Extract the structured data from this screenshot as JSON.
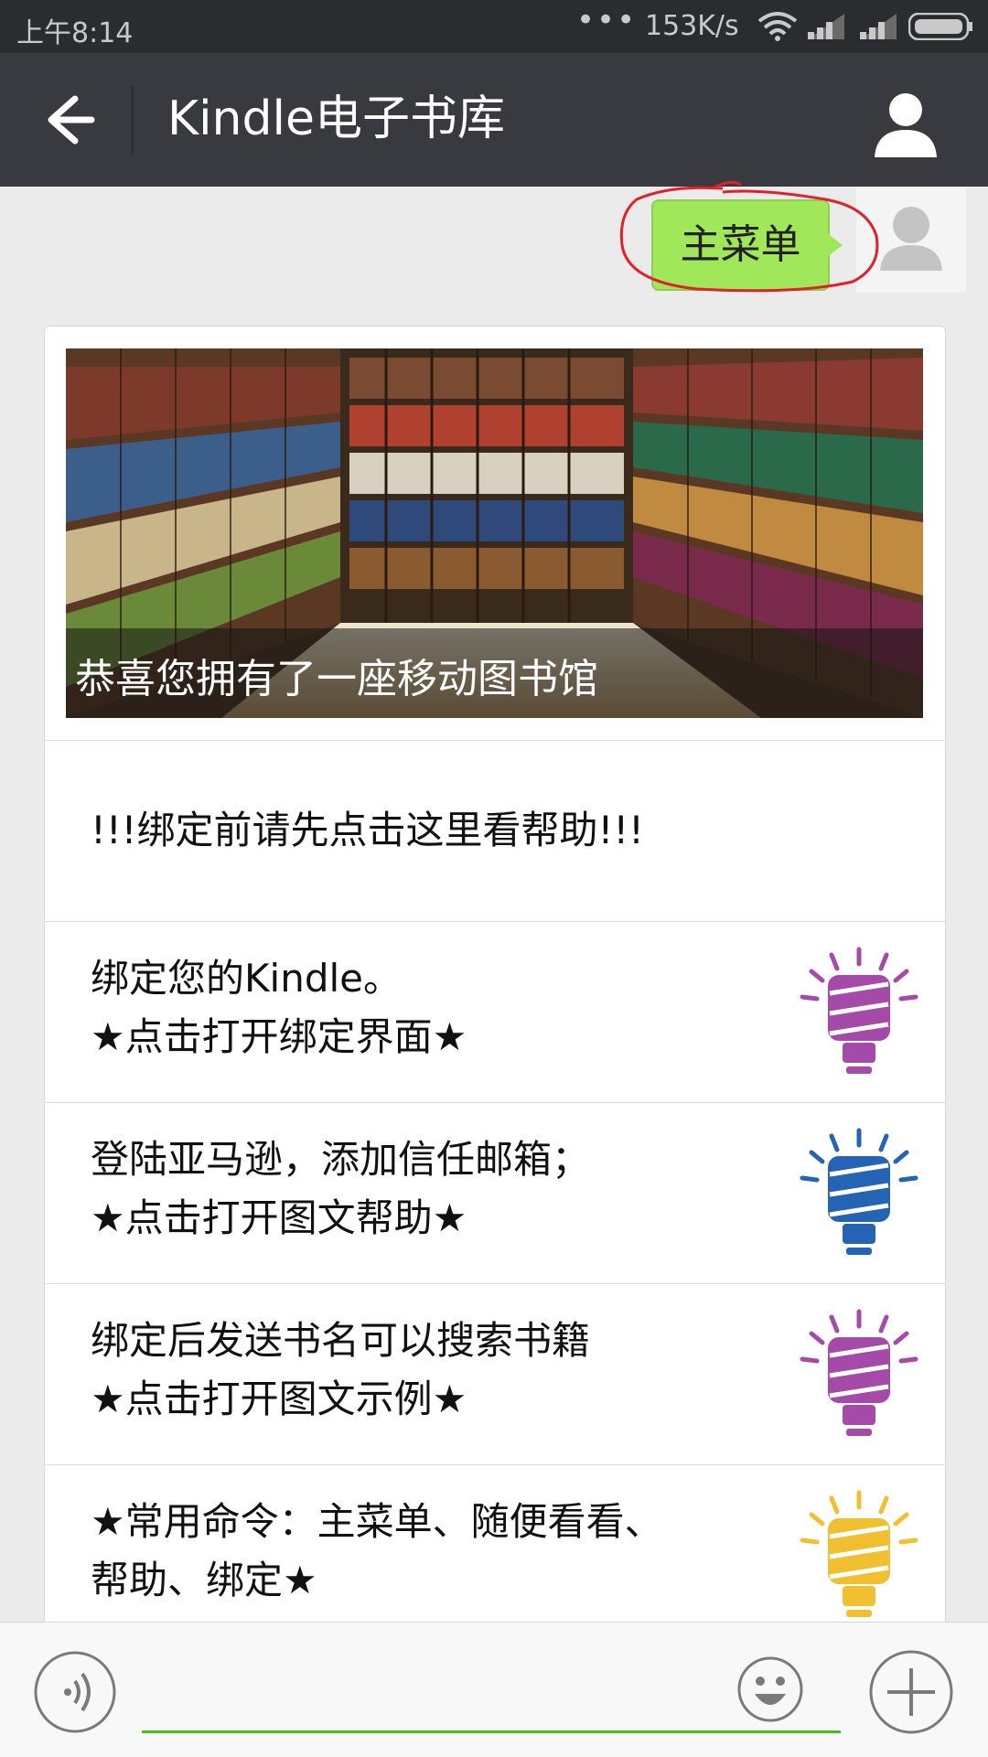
{
  "status_bar": {
    "time": "上午8:14",
    "network_speed": "153K/s",
    "more_dots": "•••"
  },
  "header": {
    "title": "Kindle电子书库",
    "back_icon": "arrow-left-icon",
    "profile_icon": "person-icon"
  },
  "chat": {
    "sent_message": "主菜单",
    "bubble_color": "#a0e75a",
    "highlight_color": "#e0202a"
  },
  "card": {
    "hero_caption": "恭喜您拥有了一座移动图书馆",
    "items": [
      {
        "text": "!!!绑定前请先点击这里看帮助!!!"
      },
      {
        "text": "绑定您的Kindle。\n★点击打开绑定界面★",
        "icon": "bulb-icon",
        "color": "#a54aa8"
      },
      {
        "text": "登陆亚马逊，添加信任邮箱；\n★点击打开图文帮助★",
        "icon": "bulb-icon",
        "color": "#2563b4"
      },
      {
        "text": "绑定后发送书名可以搜索书籍\n★点击打开图文示例★",
        "icon": "bulb-icon",
        "color": "#a54aa8"
      },
      {
        "text": "★常用命令：主菜单、随便看看、\n帮助、绑定★",
        "icon": "bulb-icon",
        "color": "#f0c030"
      }
    ]
  },
  "input_bar": {
    "voice_icon": "voice-icon",
    "emoji_icon": "smiley-icon",
    "plus_icon": "plus-icon",
    "accent": "#45c01a"
  }
}
